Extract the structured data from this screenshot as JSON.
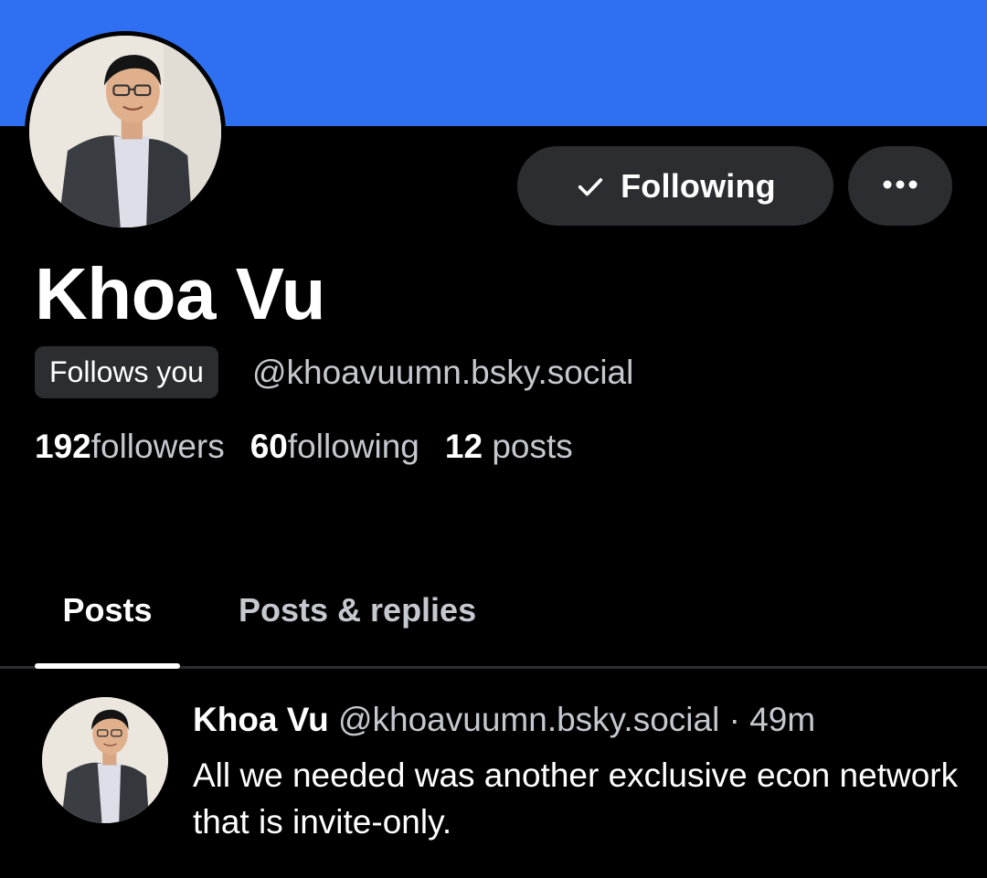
{
  "profile": {
    "display_name": "Khoa Vu",
    "follows_you_label": "Follows you",
    "handle": "@khoavuumn.bsky.social",
    "banner_color": "#2f6ff2"
  },
  "actions": {
    "following_label": "Following",
    "following_icon": "check-icon",
    "more_icon": "more-horizontal-icon"
  },
  "stats": {
    "followers_count": "192",
    "followers_label": "followers",
    "following_count": "60",
    "following_label": "following",
    "posts_count": "12",
    "posts_label": "posts"
  },
  "tabs": [
    {
      "label": "Posts",
      "active": true
    },
    {
      "label": "Posts & replies",
      "active": false
    }
  ],
  "feed": {
    "posts": [
      {
        "author": "Khoa Vu",
        "handle": "@khoavuumn.bsky.social",
        "separator": "·",
        "time": "49m",
        "text": "All we needed was another exclusive econ network that is invite-only."
      }
    ]
  }
}
